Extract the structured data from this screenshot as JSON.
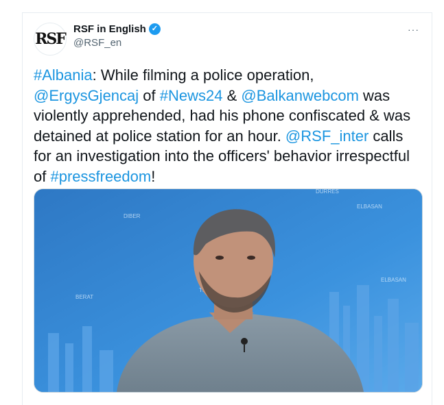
{
  "header": {
    "avatar_text": "RSF",
    "display_name": "RSF in English",
    "handle": "@RSF_en",
    "more": "···"
  },
  "tweet": {
    "segments": [
      {
        "text": "#Albania",
        "link": true
      },
      {
        "text": ": While filming a police operation, ",
        "link": false
      },
      {
        "text": "@ErgysGjencaj",
        "link": true
      },
      {
        "text": " of ",
        "link": false
      },
      {
        "text": "#News24",
        "link": true
      },
      {
        "text": " & ",
        "link": false
      },
      {
        "text": "@Balkanwebcom",
        "link": true
      },
      {
        "text": " was violently apprehended, had his phone confiscated & was detained at police station for an hour. ",
        "link": false
      },
      {
        "text": "@RSF_inter",
        "link": true
      },
      {
        "text": " calls for an investigation into the officers' behavior irrespectful of ",
        "link": false
      },
      {
        "text": "#pressfreedom",
        "link": true
      },
      {
        "text": "!",
        "link": false
      }
    ]
  },
  "media": {
    "map_labels": [
      "DURRES",
      "ELBASAN",
      "DIBER",
      "BERAT",
      "TIRANA",
      "ELBASAN"
    ]
  },
  "colors": {
    "link": "#1b95e0",
    "verified": "#1d9bf0",
    "media_bg": "#2a79c8"
  }
}
